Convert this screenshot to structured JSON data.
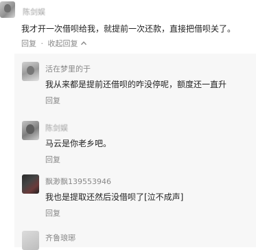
{
  "main_comment": {
    "username": "陈剑娱",
    "content": "我才开一次借呗给我，就提前一次还款，直接把借呗关了。",
    "reply_label": "回复",
    "separator": "·",
    "collapse_label": "收起回复"
  },
  "replies": [
    {
      "username": "活在梦里的于",
      "content": "我从来都是提前还借呗的咋没停呢，额度还一直升",
      "reply_label": "回复"
    },
    {
      "username": "陈剑娱",
      "content": "马云是你老乡吧。",
      "reply_label": "回复"
    },
    {
      "username": "飘渺飘139553946",
      "content": "我也是提取还然后没借呗了[泣不成声]",
      "reply_label": "回复"
    },
    {
      "username": "齐鲁琅琊",
      "content": "",
      "reply_label": ""
    }
  ]
}
